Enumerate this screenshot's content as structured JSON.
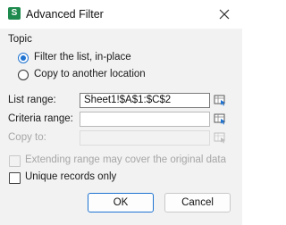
{
  "window": {
    "title": "Advanced Filter",
    "app_icon_letter": "S"
  },
  "topic": {
    "heading": "Topic",
    "options": [
      {
        "label": "Filter the list, in-place",
        "checked": true
      },
      {
        "label": "Copy to another location",
        "checked": false
      }
    ]
  },
  "fields": {
    "list_range": {
      "label": "List range:",
      "value": "Sheet1!$A$1:$C$2"
    },
    "criteria_range": {
      "label": "Criteria range:",
      "value": ""
    },
    "copy_to": {
      "label": "Copy to:",
      "value": ""
    }
  },
  "options": {
    "extending_range": {
      "label": "Extending range may cover the original data",
      "checked": false,
      "enabled": false
    },
    "unique_records": {
      "label": "Unique records only",
      "checked": false,
      "enabled": true
    }
  },
  "buttons": {
    "ok": "OK",
    "cancel": "Cancel"
  },
  "colors": {
    "accent": "#1f73d1",
    "app_icon": "#1e8a4d",
    "dialog_bg": "#f2f2f2"
  }
}
